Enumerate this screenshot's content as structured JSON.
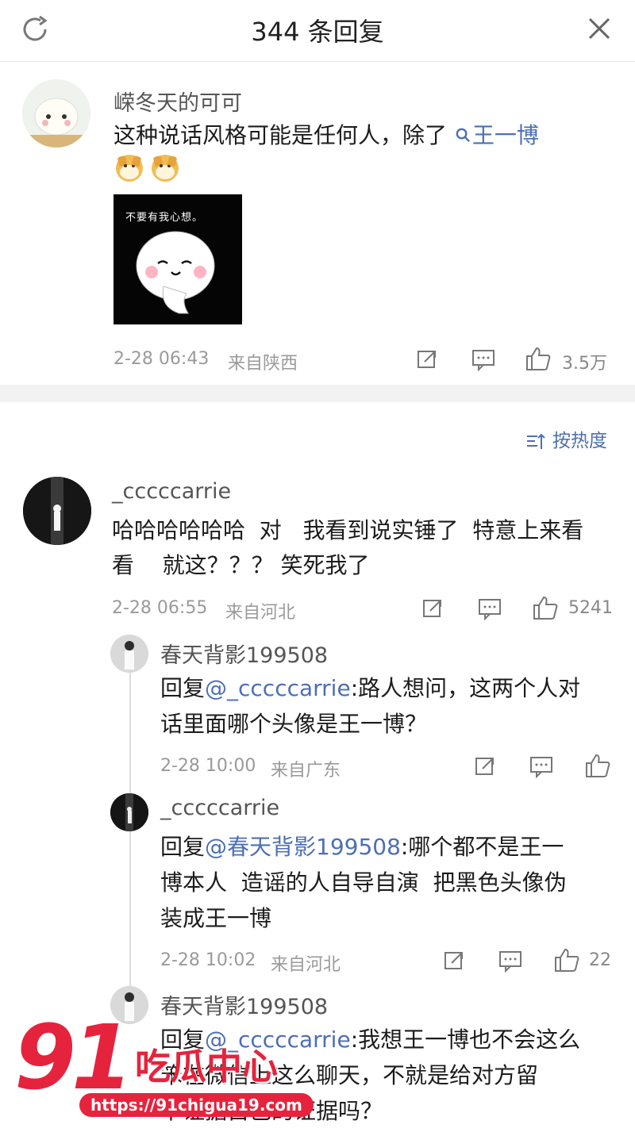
{
  "header": {
    "title": "344 条回复"
  },
  "main_comment": {
    "user": "嵘冬天的可可",
    "text_prefix": "这种说话风格可能是任何人，除了",
    "topic_link": "王一博",
    "emoji": [
      "doge",
      "doge"
    ],
    "sticker_caption": "不要有我心想。",
    "timestamp": "2-28 06:43",
    "location": "来自陕西",
    "likes": "3.5万"
  },
  "sort": {
    "label": "按热度"
  },
  "comments": [
    {
      "user": "_cccccarrie",
      "text_line1": "哈哈哈哈哈哈  对   我看到说实锤了  特意上来看",
      "text_line2": "看    就这？？？ 笑死我了",
      "timestamp": "2-28 06:55",
      "location": "来自河北",
      "likes": "5241",
      "replies": [
        {
          "user": "春天背影199508",
          "reply_prefix": "回复",
          "mention": "@_cccccarrie",
          "text_line1": ":路人想问，这两个人对",
          "text_line2": "话里面哪个头像是王一博？",
          "timestamp": "2-28 10:00",
          "location": "来自广东",
          "likes": ""
        },
        {
          "user": "_cccccarrie",
          "reply_prefix": "回复",
          "mention": "@春天背影199508",
          "text_line1": ":哪个都不是王一",
          "text_line2": "博本人  造谣的人自导自演  把黑色头像伪",
          "text_line3": "装成王一博",
          "timestamp": "2-28 10:02",
          "location": "来自河北",
          "likes": "22"
        },
        {
          "user": "春天背影199508",
          "reply_prefix": "回复",
          "mention": "@_cccccarrie",
          "text_line1": ":我想王一博也不会这么",
          "text_line2": "笨在微信上这么聊天，不就是给对方留",
          "text_line3": "下证据自己的证据吗？"
        }
      ]
    }
  ],
  "watermark": {
    "number": "91",
    "title": "吃瓜中心",
    "url": "https://91chigua19.com"
  },
  "colors": {
    "link": "#4d6fb4",
    "muted": "#9a9a9a",
    "watermark": "#e6233d"
  }
}
